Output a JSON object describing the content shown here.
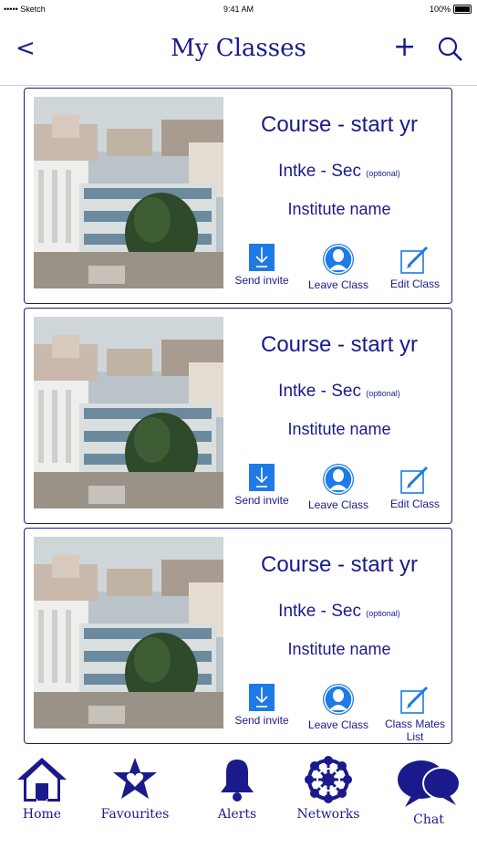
{
  "status_bar": {
    "carrier": "••••• Sketch",
    "time": "9:41 AM",
    "battery": "100%"
  },
  "nav": {
    "back": "<",
    "title": "My Classes",
    "add": "+"
  },
  "classes": [
    {
      "course": "Course - start yr",
      "intake": "Intke - Sec",
      "optional": "(optional)",
      "institute": "Institute name",
      "actions": {
        "invite": "Send invite",
        "leave": "Leave Class",
        "third": "Edit Class"
      }
    },
    {
      "course": "Course - start yr",
      "intake": "Intke - Sec",
      "optional": "(optional)",
      "institute": "Institute name",
      "actions": {
        "invite": "Send invite",
        "leave": "Leave Class",
        "third": "Edit Class"
      }
    },
    {
      "course": "Course - start yr",
      "intake": "Intke - Sec",
      "optional": "(optional)",
      "institute": "Institute name",
      "actions": {
        "invite": "Send invite",
        "leave": "Leave Class",
        "third": "Class Mates List"
      }
    }
  ],
  "tabs": {
    "home": "Home",
    "favourites": "Favourites",
    "alerts": "Alerts",
    "networks": "Networks",
    "chat": "Chat"
  },
  "colors": {
    "primary": "#1a1a8c",
    "accent": "#1e7ae6"
  }
}
